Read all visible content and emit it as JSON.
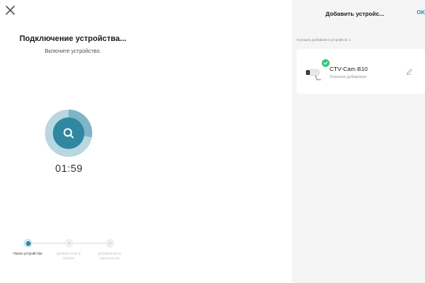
{
  "left": {
    "title": "Подключение устройства...",
    "subtitle": "Включите устройство.",
    "timer": "01:59"
  },
  "stepper": {
    "steps": [
      {
        "label": "Поиск устройства",
        "state": "active"
      },
      {
        "label": "Добави ение в облако",
        "state": "inactive"
      },
      {
        "label": "Добавление в приложение",
        "state": "inactive"
      }
    ]
  },
  "right": {
    "title": "Добавить устройс...",
    "ok_label": "OK",
    "added_count": "Успешно добавлено устройств: 1",
    "device": {
      "name": "CTV-Cam B10",
      "status": "Успешно добавлено"
    }
  },
  "icons": {
    "close": "close-icon",
    "search": "search-icon",
    "check": "check-icon",
    "edit": "pencil-icon",
    "camera": "camera-icon"
  },
  "colors": {
    "accent": "#2f87a0",
    "success": "#3cc37a",
    "right_panel_bg": "#f5f5f5"
  }
}
